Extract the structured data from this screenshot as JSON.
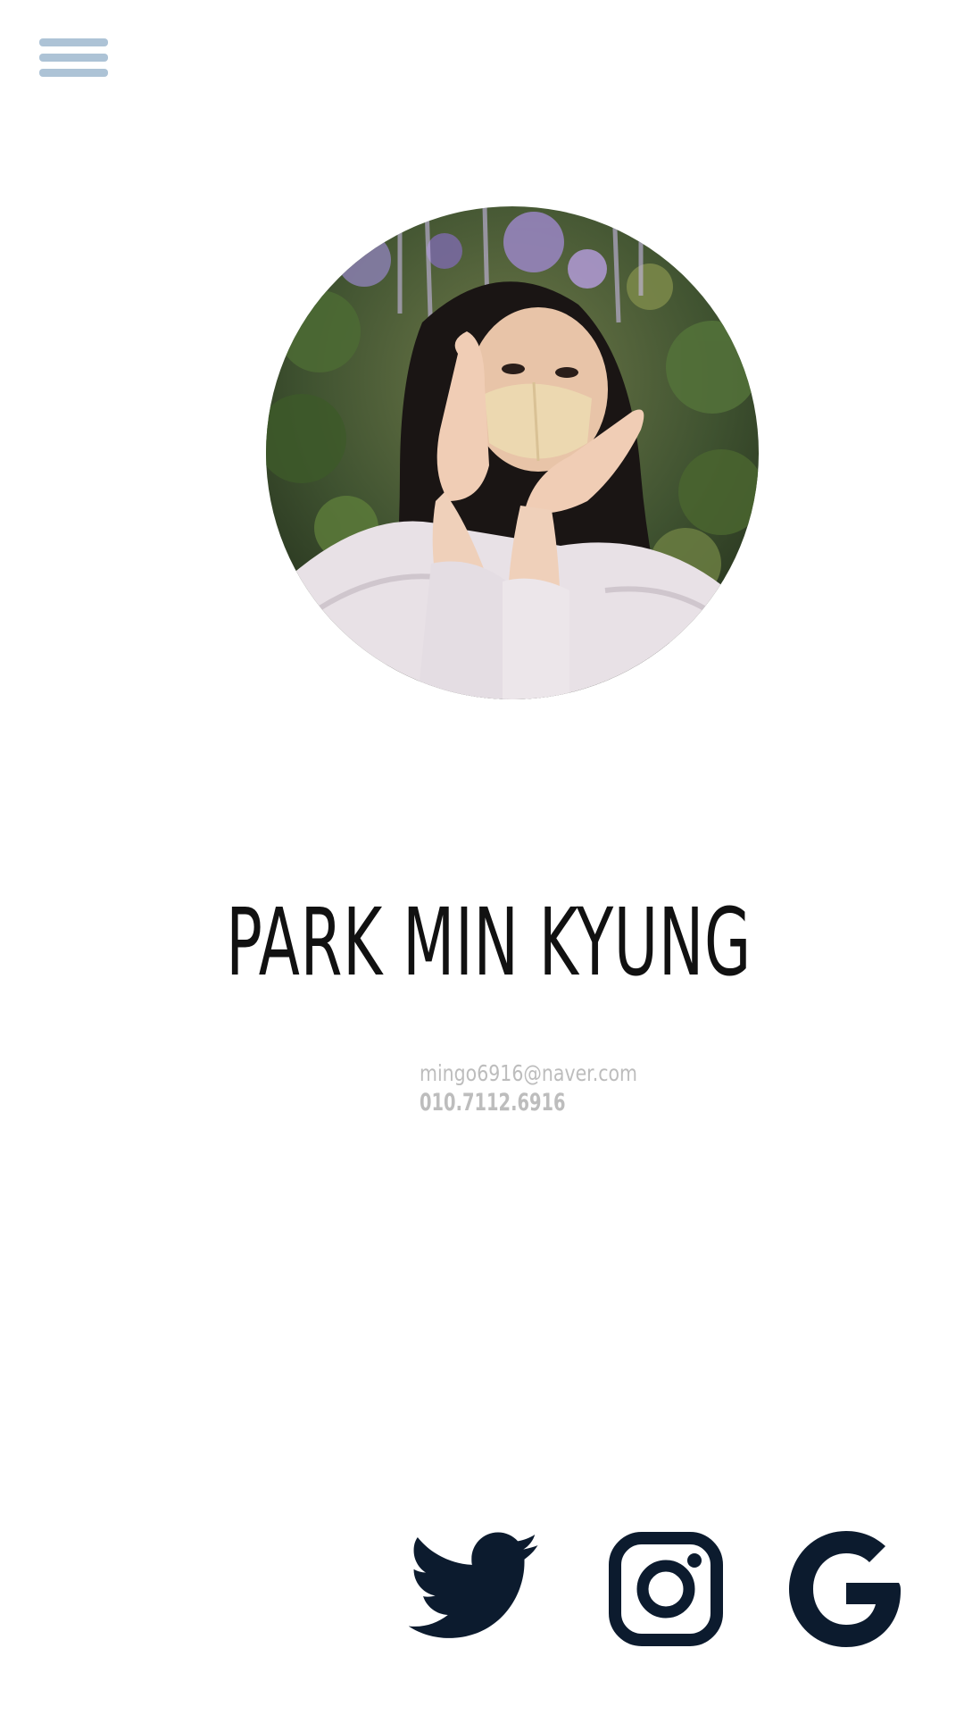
{
  "menu": {
    "icon": "hamburger-menu-icon",
    "color": "#adc3d6"
  },
  "profile": {
    "photo": "profile-photo",
    "name": "PARK MIN KYUNG",
    "email": "mingo6916@naver.com",
    "phone": "010.7112.6916"
  },
  "social": [
    {
      "icon": "twitter-icon"
    },
    {
      "icon": "instagram-icon"
    },
    {
      "icon": "google-icon"
    }
  ],
  "colors": {
    "icon": "#0c1b2e",
    "name": "#111111",
    "contact": "#bdbdbd"
  }
}
